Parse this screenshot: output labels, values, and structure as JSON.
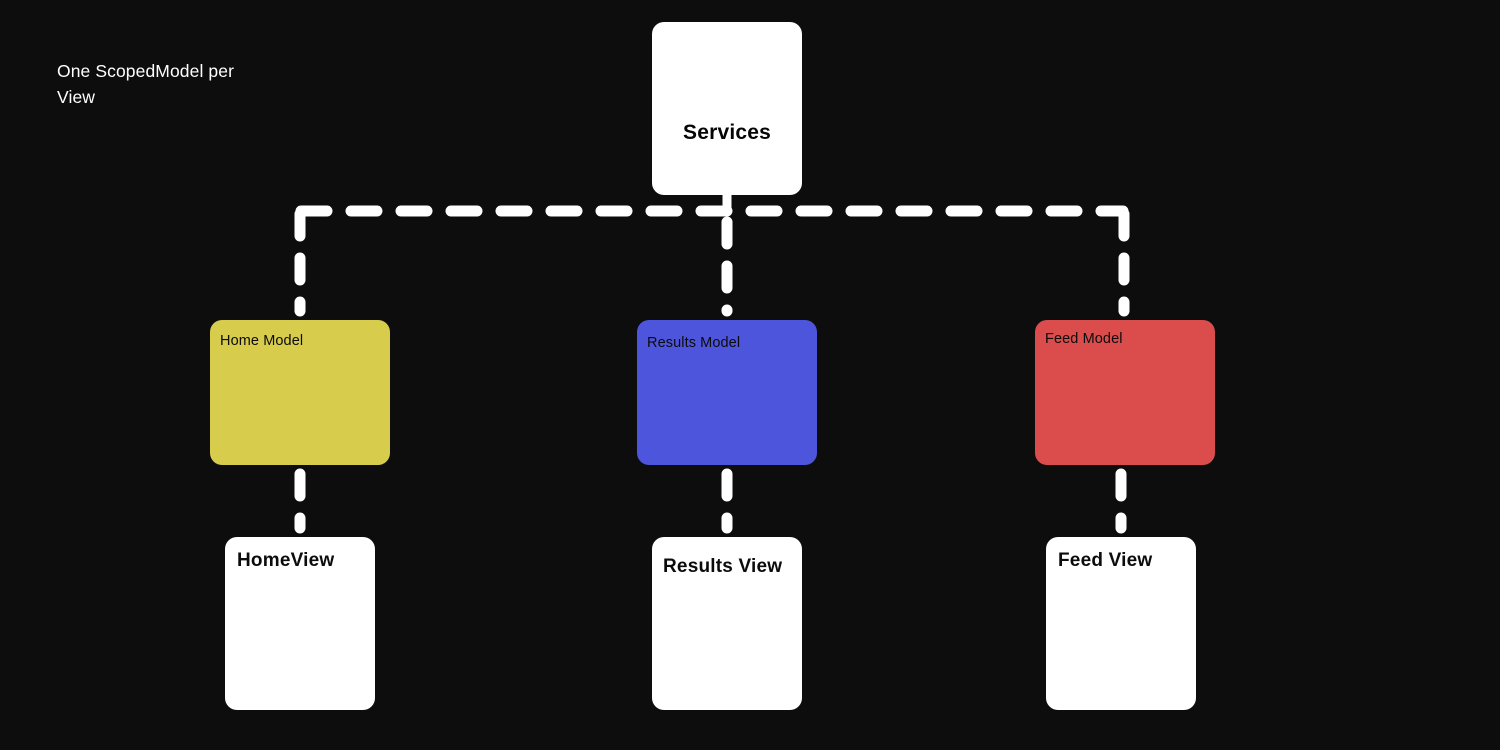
{
  "diagram": {
    "background_color": "#0d0d0d",
    "caption": "One ScopedModel per\nView",
    "wire_color": "#ffffff"
  },
  "services": {
    "label": "Services"
  },
  "models": [
    {
      "label": "Home Model",
      "color": "#d8cc4d"
    },
    {
      "label": "Results Model",
      "color": "#4d55dc"
    },
    {
      "label": "Feed Model",
      "color": "#db4c4c"
    }
  ],
  "views": [
    {
      "label": "HomeView"
    },
    {
      "label": "Results View"
    },
    {
      "label": "Feed View"
    }
  ]
}
